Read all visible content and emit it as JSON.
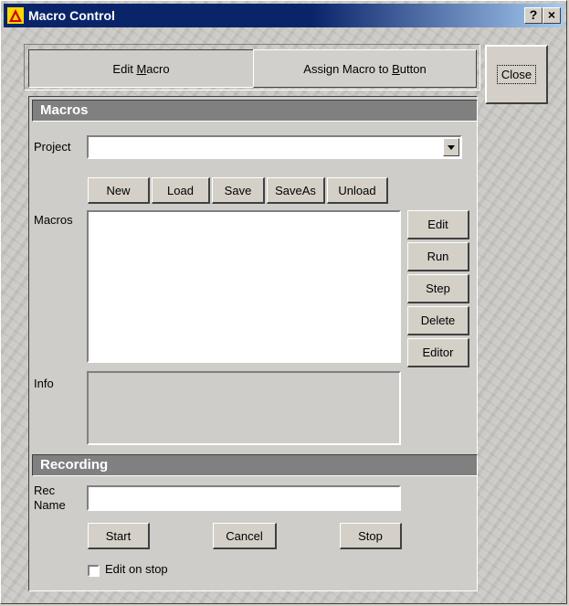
{
  "window": {
    "title": "Macro Control",
    "help_label": "?",
    "close_label": "×"
  },
  "tabs": [
    {
      "pre": "Edit ",
      "key": "M",
      "post": "acro"
    },
    {
      "pre": "Assign Macro to ",
      "key": "B",
      "post": "utton"
    }
  ],
  "close_button": "Close",
  "macros": {
    "header": "Macros",
    "project_label": "Project",
    "project_value": "",
    "buttons": {
      "new": "New",
      "load": "Load",
      "save": "Save",
      "saveas": "SaveAs",
      "unload": "Unload"
    },
    "list_label": "Macros",
    "side_buttons": {
      "edit": "Edit",
      "run": "Run",
      "step": "Step",
      "delete": "Delete",
      "editor": "Editor"
    },
    "info_label": "Info"
  },
  "recording": {
    "header": "Recording",
    "rec_name_label_1": "Rec",
    "rec_name_label_2": "Name",
    "rec_name_value": "",
    "buttons": {
      "start": "Start",
      "cancel": "Cancel",
      "stop": "Stop"
    },
    "edit_on_stop": "Edit on stop",
    "edit_on_stop_checked": false
  }
}
